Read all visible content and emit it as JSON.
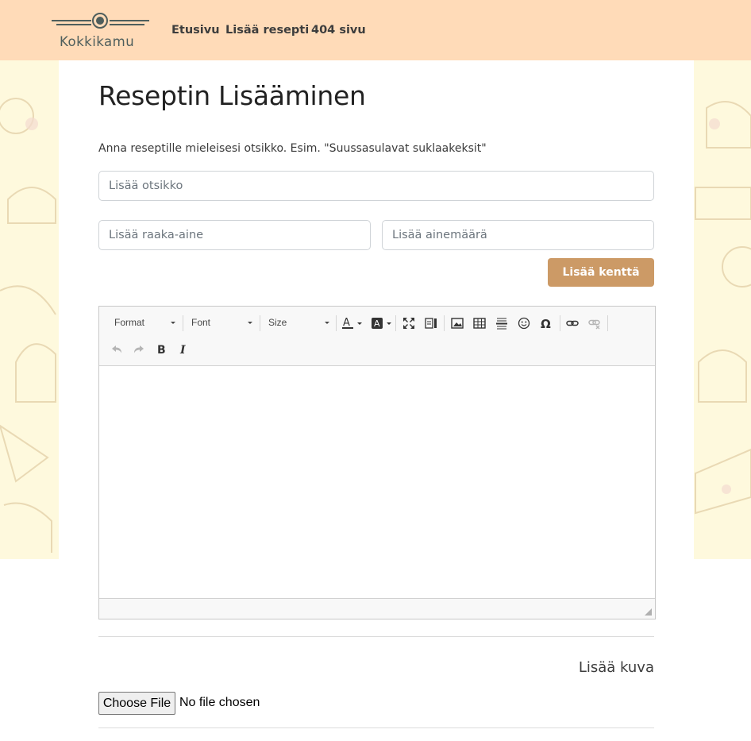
{
  "nav": {
    "logo_text": "Kokkikamu",
    "links": [
      "Etusivu",
      "Lisää resepti",
      "404 sivu"
    ]
  },
  "page": {
    "title": "Reseptin Lisääminen",
    "hint": "Anna reseptille mieleisesi otsikko. Esim. \"Suussasulavat suklaakeksit\""
  },
  "form": {
    "title_placeholder": "Lisää otsikko",
    "ingredient_placeholder": "Lisää raaka-aine",
    "amount_placeholder": "Lisää ainemäärä",
    "add_field_label": "Lisää kenttä"
  },
  "editor": {
    "combos": [
      "Format",
      "Font",
      "Size"
    ],
    "icons": [
      "text-color-icon",
      "background-color-icon",
      "maximize-icon",
      "show-blocks-icon",
      "image-icon",
      "table-icon",
      "horizontal-line-icon",
      "smiley-icon",
      "special-char-icon",
      "link-icon",
      "unlink-icon",
      "undo-icon",
      "redo-icon",
      "bold-icon",
      "italic-icon"
    ]
  },
  "image_section": {
    "label": "Lisää kuva",
    "choose_file_label": "Choose File",
    "file_status": "No file chosen"
  },
  "colors": {
    "navbar_bg": "#ffdbb8",
    "accent": "#cc9a66",
    "pattern_bg": "#fef9dd"
  }
}
